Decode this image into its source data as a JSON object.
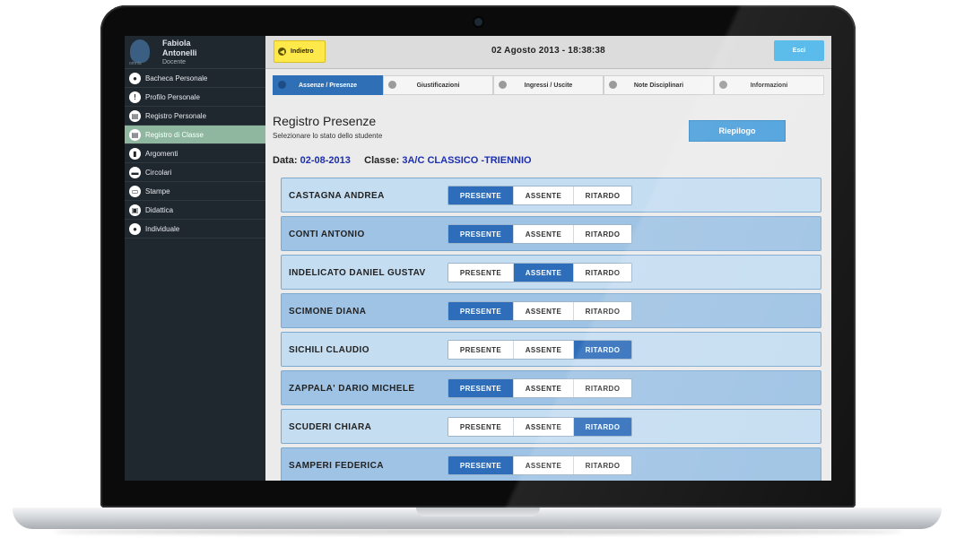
{
  "user": {
    "first_name": "Fabiola",
    "last_name": "Antonelli",
    "role": "Docente",
    "logo_text": "omnia"
  },
  "sidebar": {
    "items": [
      {
        "label": "Bacheca Personale",
        "icon": "person-icon",
        "glyph": "●"
      },
      {
        "label": "Profilo Personale",
        "icon": "info-icon",
        "glyph": "!"
      },
      {
        "label": "Registro Personale",
        "icon": "register-icon",
        "glyph": "▤"
      },
      {
        "label": "Registro di Classe",
        "icon": "class-register-icon",
        "glyph": "▤",
        "active": true
      },
      {
        "label": "Argomenti",
        "icon": "document-icon",
        "glyph": "▮"
      },
      {
        "label": "Circolari",
        "icon": "circulars-icon",
        "glyph": "▬"
      },
      {
        "label": "Stampe",
        "icon": "print-icon",
        "glyph": "▭"
      },
      {
        "label": "Didattica",
        "icon": "didactics-icon",
        "glyph": "▣"
      },
      {
        "label": "Individuale",
        "icon": "individual-icon",
        "glyph": "●"
      }
    ]
  },
  "topbar": {
    "back_label": "Indietro",
    "datetime": "02 Agosto 2013 - 18:38:38",
    "exit_label": "Esci"
  },
  "tabs": [
    {
      "label": "Assenze / Presenze",
      "active": true
    },
    {
      "label": "Giustificazioni"
    },
    {
      "label": "Ingressi / Uscite"
    },
    {
      "label": "Note Disciplinari"
    },
    {
      "label": "Informazioni"
    }
  ],
  "main": {
    "title": "Registro Presenze",
    "subtitle": "Selezionare lo stato dello studente",
    "summary_label": "Riepilogo",
    "date_label": "Data:",
    "date_value": "02-08-2013",
    "class_label": "Classe:",
    "class_value": "3A/C CLASSICO -TRIENNIO"
  },
  "status_options": [
    "PRESENTE",
    "ASSENTE",
    "RITARDO"
  ],
  "students": [
    {
      "name": "CASTAGNA ANDREA",
      "status": "PRESENTE"
    },
    {
      "name": "CONTI ANTONIO",
      "status": "PRESENTE"
    },
    {
      "name": "INDELICATO DANIEL GUSTAV",
      "status": "ASSENTE"
    },
    {
      "name": "SCIMONE DIANA",
      "status": "PRESENTE"
    },
    {
      "name": "SICHILI CLAUDIO",
      "status": "RITARDO"
    },
    {
      "name": "ZAPPALA' DARIO MICHELE",
      "status": "PRESENTE"
    },
    {
      "name": "SCUDERI CHIARA",
      "status": "RITARDO"
    },
    {
      "name": "SAMPERI FEDERICA",
      "status": "PRESENTE"
    }
  ],
  "colors": {
    "accent": "#2e6dba",
    "sidebar_bg": "#20282f",
    "active_nav": "#8fb7a0",
    "back_button": "#ffe94a",
    "exit_button": "#4cb5e8"
  }
}
